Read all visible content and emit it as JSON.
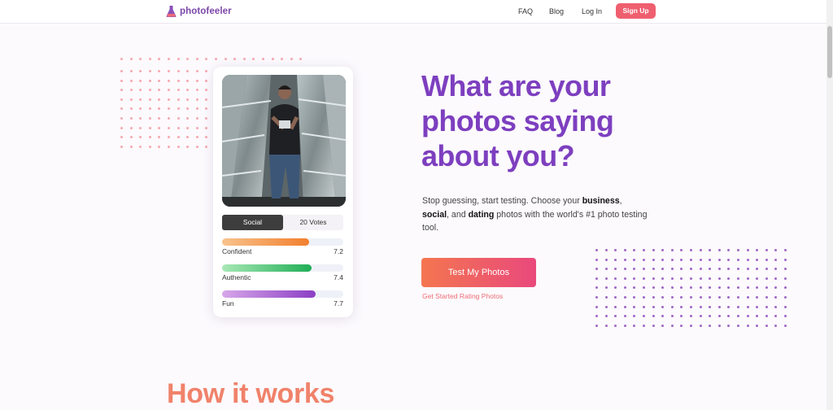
{
  "nav": {
    "logo_text": "photofeeler",
    "links": [
      "FAQ",
      "Blog",
      "Log In"
    ],
    "signup_label": "Sign Up"
  },
  "card": {
    "tabs": {
      "active": "Social",
      "votes": "20 Votes"
    },
    "metrics": [
      {
        "label": "Confident",
        "score": "7.2",
        "fill": 0.72,
        "color_from": "#f8c38d",
        "color_to": "#f27f2d"
      },
      {
        "label": "Authentic",
        "score": "7.4",
        "fill": 0.74,
        "color_from": "#a8e8b6",
        "color_to": "#1fae55"
      },
      {
        "label": "Fun",
        "score": "7.7",
        "fill": 0.77,
        "color_from": "#d7a7ea",
        "color_to": "#8b3fc4"
      }
    ]
  },
  "hero": {
    "headline": "What are your photos saying about you?",
    "desc_1": "Stop guessing, start testing. Choose your ",
    "desc_b1": "business",
    "desc_2": ", ",
    "desc_b2": "social",
    "desc_3": ", and ",
    "desc_b3": "dating",
    "desc_4": " photos with the world's #1 photo testing tool.",
    "cta_label": "Test My Photos",
    "cta_sub": "Get Started Rating Photos"
  },
  "section": {
    "title": "How it works"
  },
  "colors": {
    "brand_purple": "#7b46a8",
    "signup": "#ef5f6f",
    "dots_pink": "#f7a8b0",
    "dots_purple": "#a067c6"
  }
}
